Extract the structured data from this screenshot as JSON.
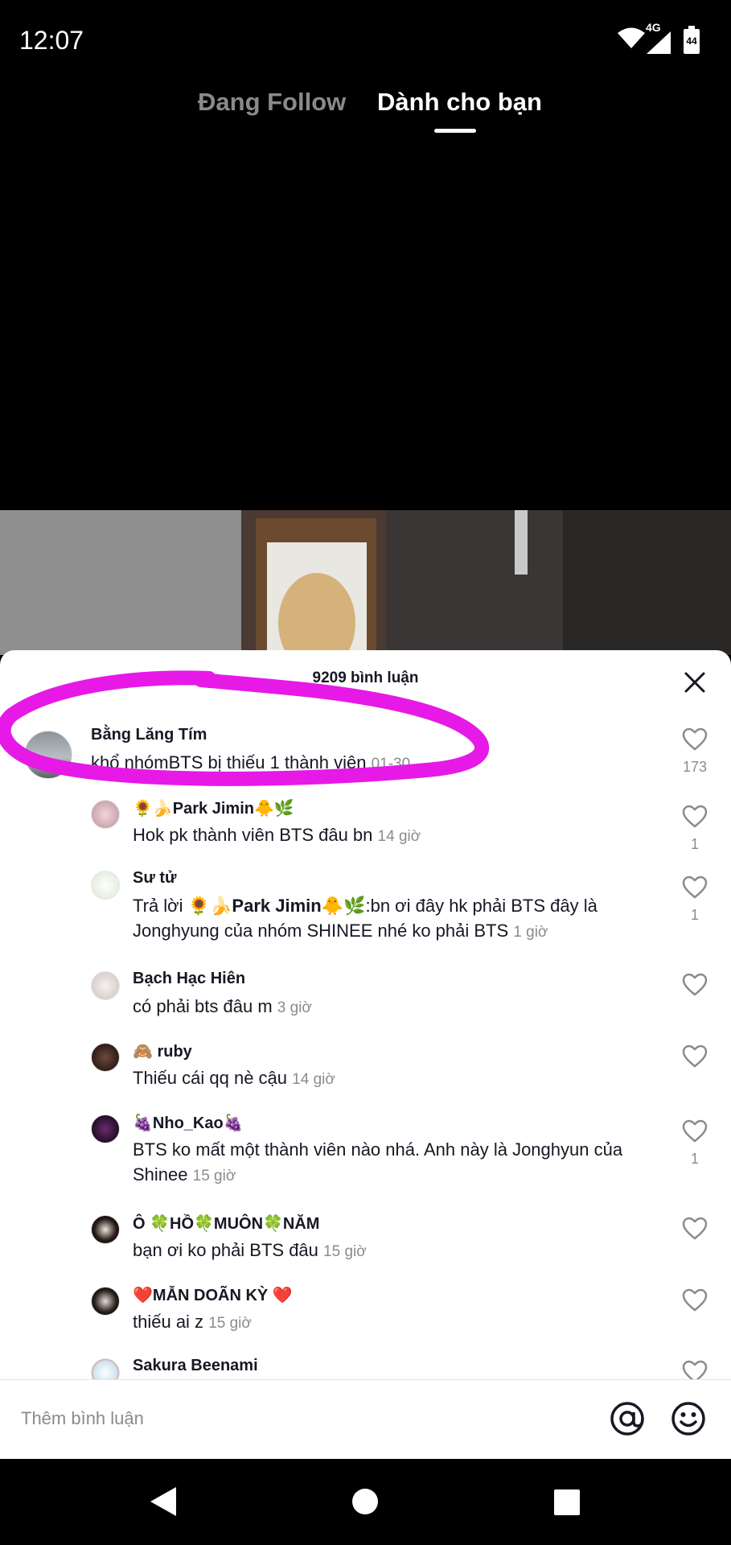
{
  "status_bar": {
    "time": "12:07",
    "network": "4G",
    "battery": "44"
  },
  "feed_tabs": {
    "following": "Đang Follow",
    "for_you": "Dành cho bạn"
  },
  "comments_panel": {
    "title": "9209 bình luận",
    "comments": [
      {
        "author": "Bằng Lăng Tím",
        "text": "khổ nhómBTS bị thiếu 1 thành viên",
        "time": "01-30",
        "likes": "173"
      },
      {
        "author": "🌻🍌Park Jimin🐥🌿",
        "text": "Hok pk thành viên BTS đâu bn",
        "time": "14 giờ",
        "likes": "1"
      },
      {
        "author": "Sư tử",
        "text_prefix": "Trả lời ",
        "mention": "🌻🍌Park Jimin🐥🌿",
        "text": ":bn ơi đây hk phải BTS đây là Jonghyung của nhóm SHINEE nhé ko phải BTS",
        "time": "1 giờ",
        "likes": "1"
      },
      {
        "author": "Bạch Hạc Hiên",
        "text": "có phải bts đâu m",
        "time": "3 giờ",
        "likes": ""
      },
      {
        "author": "🙈 ruby",
        "text": "Thiếu cái qq nè cậu",
        "time": "14 giờ",
        "likes": ""
      },
      {
        "author": "🍇Nho_Kao🍇",
        "text": "BTS ko mất một thành viên nào nhá. Anh này là Jonghyun của Shinee",
        "time": "15 giờ",
        "likes": "1"
      },
      {
        "author": "Ô 🍀HỒ🍀MUÔN🍀NĂM",
        "text": "bạn ơi ko phải BTS đâu",
        "time": "15 giờ",
        "likes": ""
      },
      {
        "author": "❤️MẪN DOÃN KỲ ❤️",
        "text": "thiếu ai z",
        "time": "15 giờ",
        "likes": ""
      },
      {
        "author": "Sakura Beenami",
        "text": "",
        "time": "",
        "likes": ""
      }
    ]
  },
  "comment_input": {
    "placeholder": "Thêm bình luận"
  },
  "icons": {
    "close": "close-icon",
    "like": "heart-outline-icon",
    "mention": "at-sign-icon",
    "emoji": "smiley-icon",
    "nav_back": "triangle-back-icon",
    "nav_home": "circle-home-icon",
    "nav_recent": "square-recents-icon"
  },
  "colors": {
    "highlight_marker": "#e619e6",
    "secondary_text": "#8a8b91"
  }
}
